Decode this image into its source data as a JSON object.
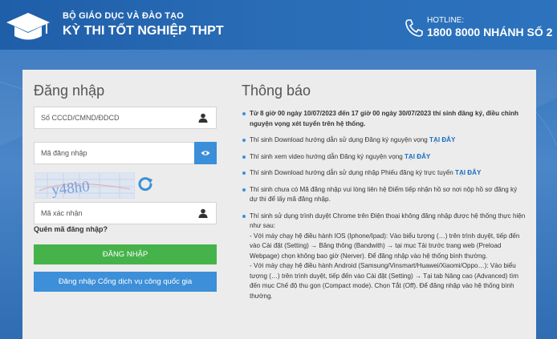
{
  "header": {
    "org_line1": "BỘ GIÁO DỤC VÀ ĐÀO TẠO",
    "org_line2": "KỲ THI TỐT NGHIỆP THPT",
    "hotline_label": "HOTLINE:",
    "hotline_number": "1800 8000 NHÁNH SỐ 2"
  },
  "login": {
    "title": "Đăng nhập",
    "id_placeholder": "Số CCCD/CMND/ĐDCD",
    "password_placeholder": "Mã đăng nhập",
    "captcha_text": "y48h0",
    "captcha_placeholder": "Mã xác nhận",
    "forgot_label": "Quên mã đăng nhập?",
    "submit_label": "ĐĂNG NHẬP",
    "portal_label": "Đăng nhập Cổng dịch vụ công quốc gia"
  },
  "notices": {
    "title": "Thông báo",
    "items": [
      {
        "text": "Từ 8 giờ 00 ngày 10/07/2023 đến 17 giờ 00 ngày 30/07/2023 thí sinh đăng ký, điều chỉnh nguyện vọng xét tuyển trên hệ thống."
      },
      {
        "text": "Thí sinh Download hướng dẫn sử dụng Đăng ký nguyện vọng ",
        "link": "TẠI ĐÂY"
      },
      {
        "text": "Thí sinh xem video hướng dẫn Đăng ký nguyện vọng ",
        "link": "TẠI ĐÂY"
      },
      {
        "text": "Thí sinh Download hướng dẫn sử dụng nhập Phiếu đăng ký trực tuyến ",
        "link": "TẠI ĐÂY"
      },
      {
        "text": "Thí sinh chưa có Mã đăng nhập vui lòng liên hệ Điểm tiếp nhận hồ sơ nơi nộp hồ sơ đăng ký dự thi để lấy mã đăng nhập."
      },
      {
        "text": "Thí sinh sử dụng trình duyệt Chrome trên Điện thoại không đăng nhập được hệ thống thực hiện như sau:",
        "sub1": "- Với máy chạy hệ điều hành IOS (Iphone/Ipad): Vào biểu tượng (…) trên trình duyệt, tiếp đến vào Cài đặt (Setting) → Băng thông (Bandwith) → tại mục Tải trước trang web (Preload Webpage) chọn không bao giờ (Nerver). Để đăng nhập vào hệ thống bình thường.",
        "sub2": "- Với máy chạy hệ điều hành Android (Samsung/Vinsmart/Huawei/Xiaomi/Oppo…): Vào biểu tượng (…) trên trình duyệt, tiếp đến vào Cài đặt (Setting) → Tại tab Nâng cao (Advanced) tìm đến mục Chế độ thu gọn (Compact mode). Chọn Tắt (Off). Để đăng nhập vào hệ thống bình thường."
      }
    ]
  }
}
